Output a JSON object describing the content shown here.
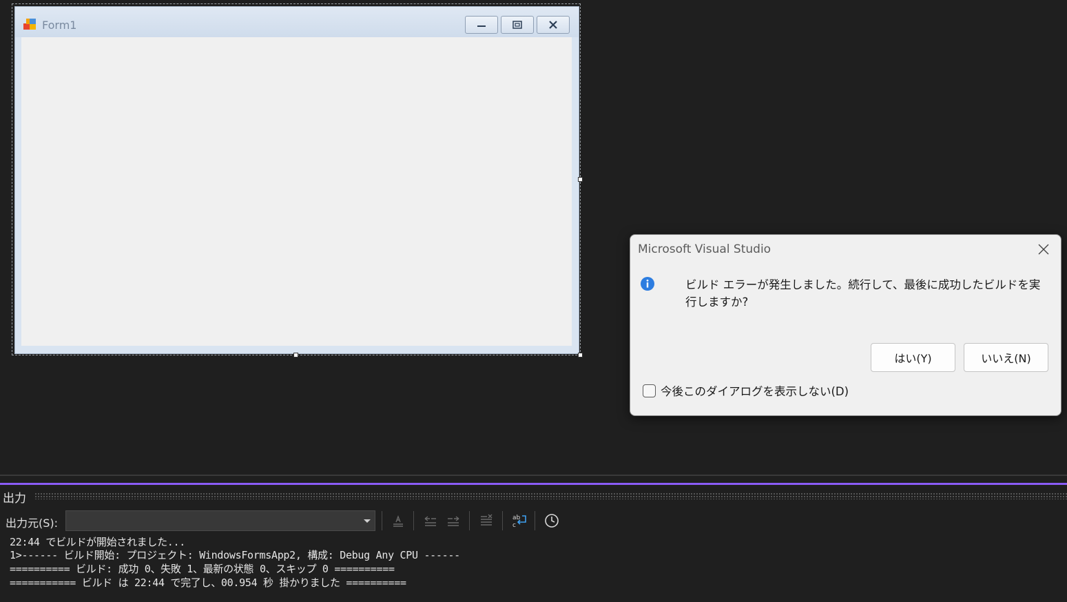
{
  "form": {
    "title": "Form1"
  },
  "dialog": {
    "title": "Microsoft Visual Studio",
    "message": "ビルド エラーが発生しました。続行して、最後に成功したビルドを実行しますか?",
    "yes_label": "はい(Y)",
    "no_label": "いいえ(N)",
    "checkbox_label": "今後このダイアログを表示しない(D)",
    "checkbox_checked": false,
    "info_color": "#2d7de0"
  },
  "output_panel": {
    "title": "出力",
    "source_label": "出力元(S):",
    "source_value": "",
    "accent_color": "#8a5cf5",
    "lines": [
      "22:44 でビルドが開始されました...",
      "1>------ ビルド開始: プロジェクト: WindowsFormsApp2, 構成: Debug Any CPU ------",
      "========== ビルド: 成功 0、失敗 1、最新の状態 0、スキップ 0 ==========",
      "=========== ビルド は 22:44 で完了し、00.954 秒 掛かりました =========="
    ]
  }
}
